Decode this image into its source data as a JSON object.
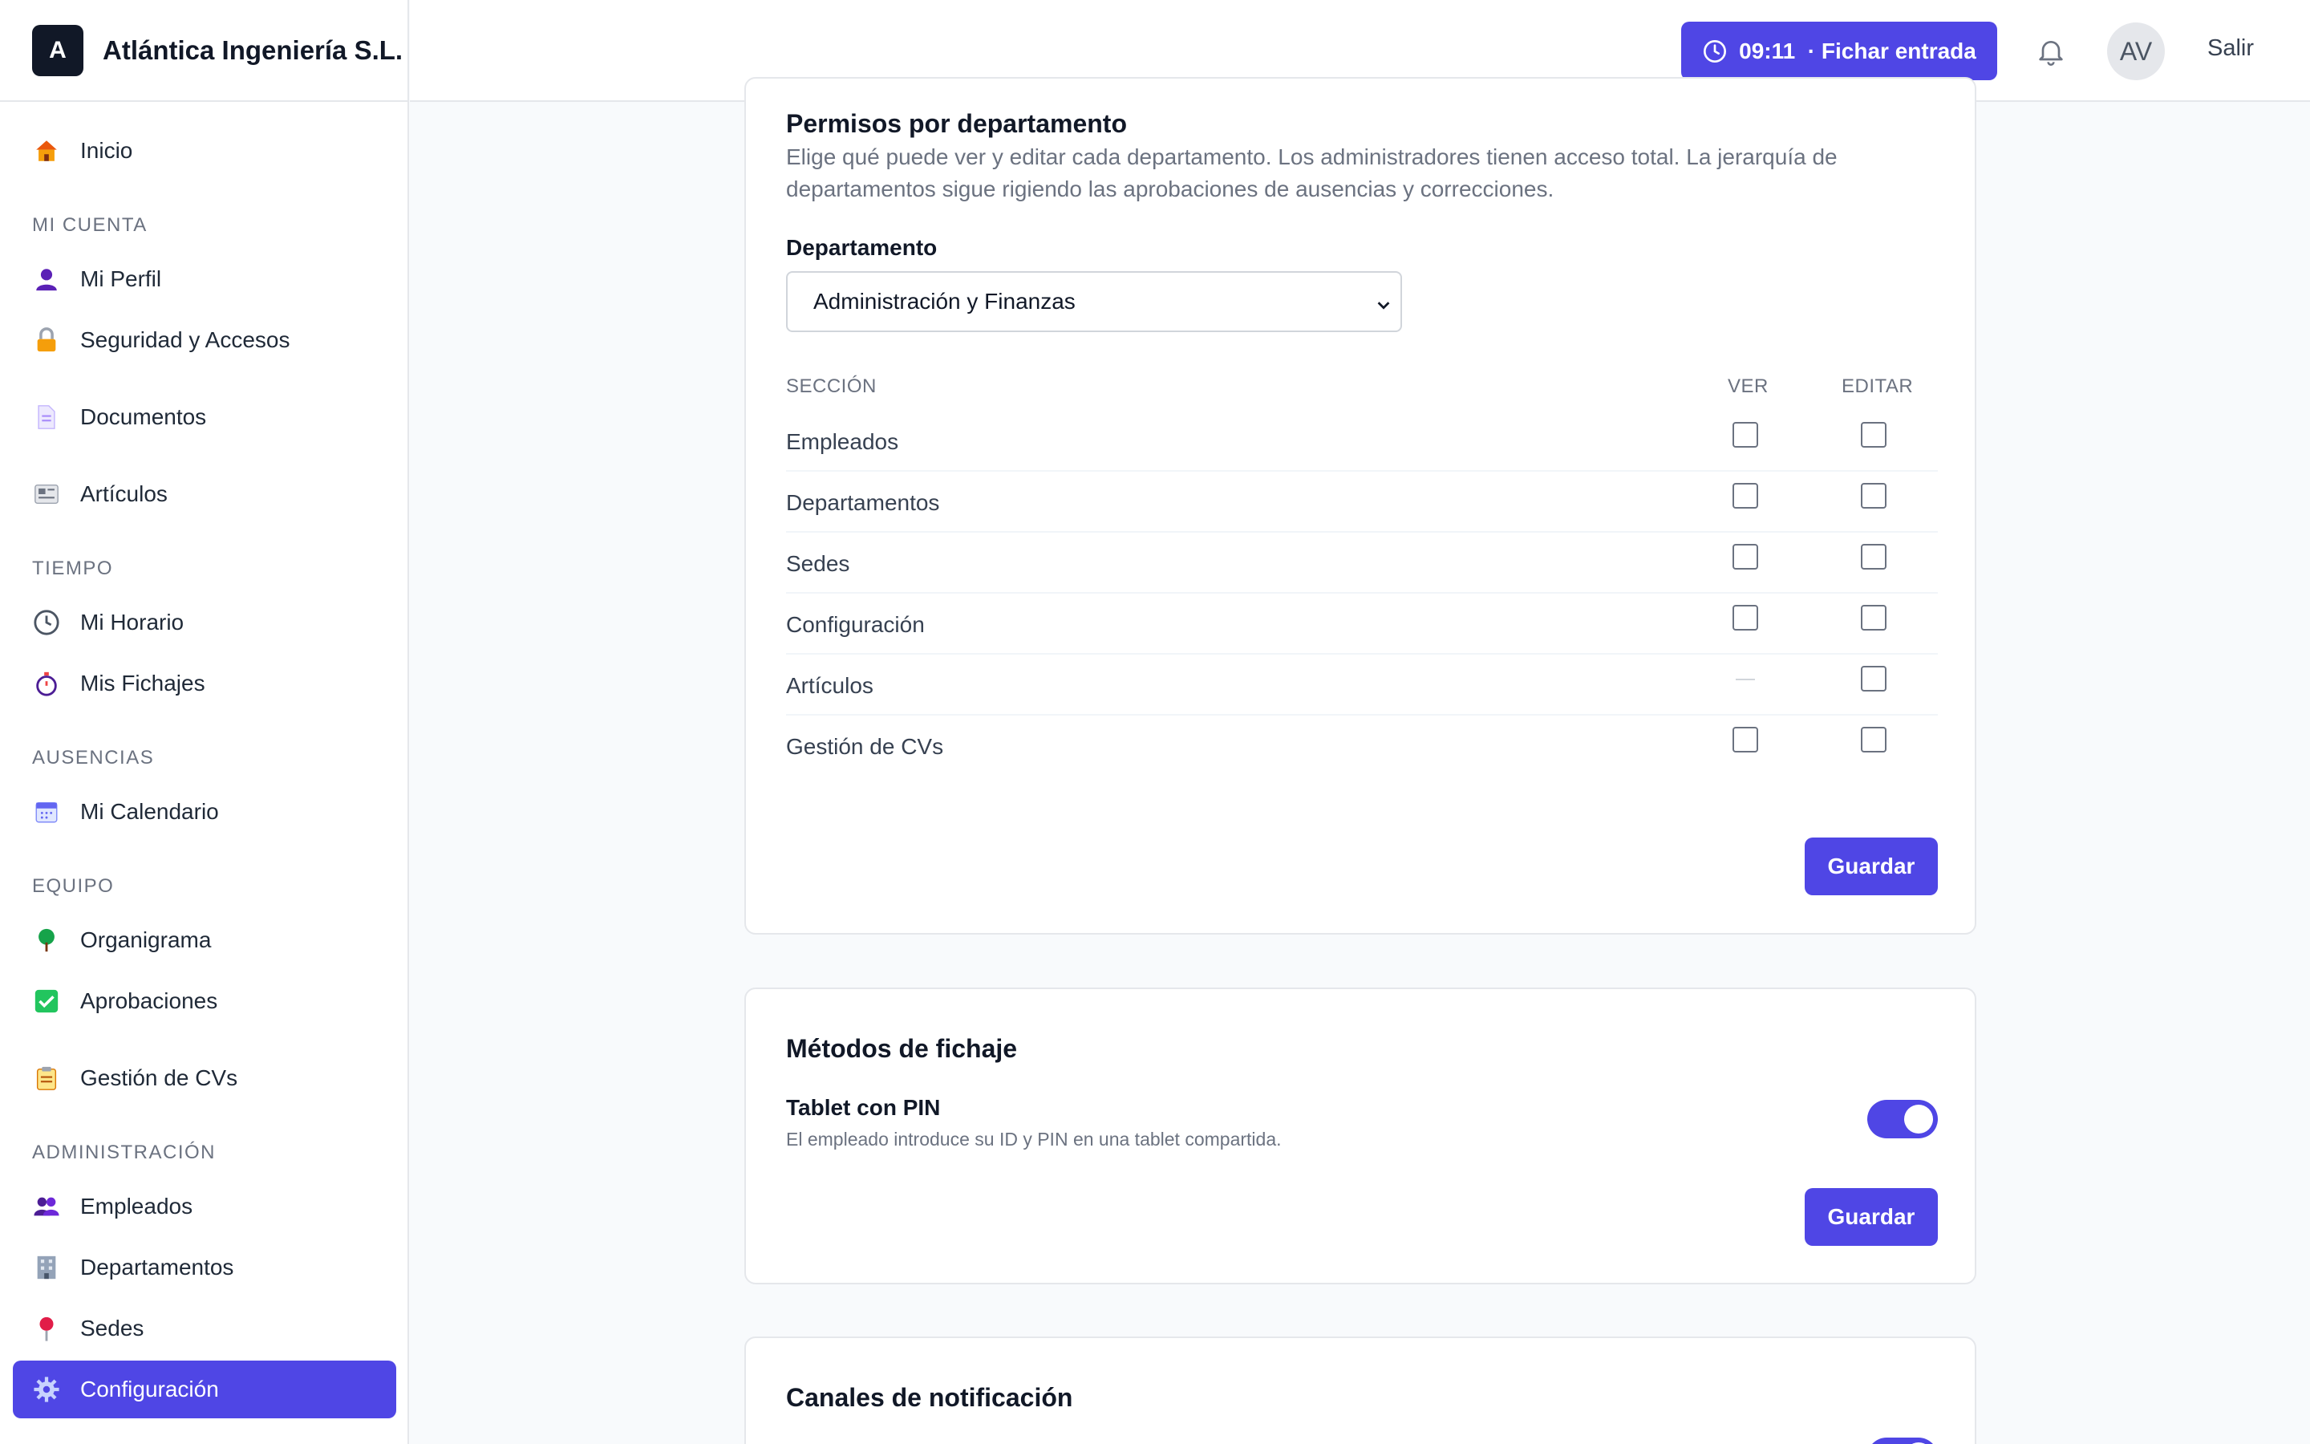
{
  "brand": {
    "logo_letter": "A",
    "name": "Atlántica Ingeniería S.L."
  },
  "sidebar": {
    "inicio": "Inicio",
    "section_cuenta": "MI CUENTA",
    "perfil": "Mi Perfil",
    "seguridad": "Seguridad y Accesos",
    "documentos": "Documentos",
    "articulos": "Artículos",
    "section_tiempo": "TIEMPO",
    "horario": "Mi Horario",
    "fichajes": "Mis Fichajes",
    "section_ausencias": "AUSENCIAS",
    "calendario": "Mi Calendario",
    "section_equipo": "EQUIPO",
    "organigrama": "Organigrama",
    "aprobaciones": "Aprobaciones",
    "cvs": "Gestión de CVs",
    "section_admin": "ADMINISTRACIÓN",
    "empleados": "Empleados",
    "departamentos": "Departamentos",
    "sedes": "Sedes",
    "configuracion": "Configuración"
  },
  "header": {
    "clock_label": "09:11  · Fichar entrada",
    "avatar_initials": "AV",
    "logout": "Salir"
  },
  "permisos": {
    "title": "Permisos por departamento",
    "description": "Elige qué puede ver y editar cada departamento. Los administradores tienen acceso total. La jerarquía de departamentos sigue rigiendo las aprobaciones de ausencias y correcciones.",
    "dept_label": "Departamento",
    "dept_selected": "Administración y Finanzas",
    "col_section": "SECCIÓN",
    "col_ver": "VER",
    "col_editar": "EDITAR",
    "rows": [
      {
        "label": "Empleados",
        "ver": false,
        "editar": false
      },
      {
        "label": "Departamentos",
        "ver": false,
        "editar": false
      },
      {
        "label": "Sedes",
        "ver": false,
        "editar": false
      },
      {
        "label": "Configuración",
        "ver": false,
        "editar": false
      },
      {
        "label": "Artículos",
        "ver": null,
        "editar": false
      },
      {
        "label": "Gestión de CVs",
        "ver": false,
        "editar": false
      }
    ],
    "save": "Guardar"
  },
  "metodos": {
    "title": "Métodos de fichaje",
    "tablet_title": "Tablet con PIN",
    "tablet_desc": "El empleado introduce su ID y PIN en una tablet compartida.",
    "tablet_enabled": true,
    "save": "Guardar"
  },
  "canales": {
    "title": "Canales de notificación"
  },
  "colors": {
    "accent": "#4f46e5",
    "sidebar_active": "#4f46e5",
    "text": "#111827"
  }
}
